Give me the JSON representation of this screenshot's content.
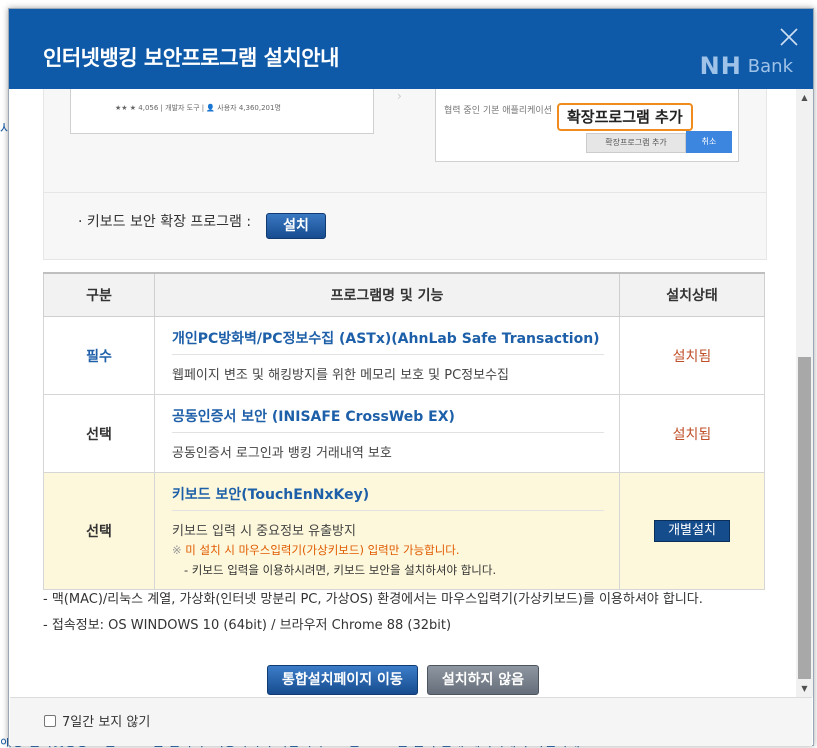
{
  "background": {
    "left_fragment": "사",
    "bottom_fragment": "해당 인터넷뱅킹 보안프로그램 설치 후 이용하시기 바랍니다 · 보안프로그램 설치 안내 페이지에서 확인하세요"
  },
  "modal": {
    "title": "인터넷뱅킹 보안프로그램 설치안내",
    "brand_nh": "NH",
    "brand_bank": "Bank"
  },
  "illustration": {
    "left_caption": "★★ ★ 4,056 | 개발자 도구 | 👤 사용자 4,360,201명",
    "right_caption": "협력 중인 기본 애플리케이션",
    "callout": "확장프로그램 추가",
    "add_label": "확장프로그램 추가",
    "cancel_label": "취소"
  },
  "keyboard_ext": {
    "label": "· 키보드 보안 확장 프로그램 :",
    "install_button": "설치"
  },
  "table": {
    "headers": {
      "type": "구분",
      "program": "프로그램명 및 기능",
      "status": "설치상태"
    },
    "rows": [
      {
        "type": "필수",
        "name": "개인PC방화벽/PC정보수집 (ASTx)(AhnLab Safe Transaction)",
        "desc": "웹페이지 변조 및 해킹방지를 위한 메모리 보호 및 PC정보수집",
        "status": "설치됨"
      },
      {
        "type": "선택",
        "name": "공동인증서 보안 (INISAFE CrossWeb EX)",
        "desc": "공동인증서 로그인과 뱅킹 거래내역 보호",
        "status": "설치됨"
      },
      {
        "type": "선택",
        "name": "키보드 보안(TouchEnNxKey)",
        "desc": "키보드 입력 시 중요정보 유출방지",
        "warn_mark": "※",
        "warn": "미 설치 시 마우스입력기(가상키보드) 입력만 가능합니다.",
        "sub_note": "- 키보드 입력을 이용하시려면, 키보드 보안을 설치하셔야 합니다.",
        "action": "개별설치"
      }
    ]
  },
  "notes": [
    "- 맥(MAC)/리눅스 계열, 가상화(인터넷 망분리 PC, 가상OS) 환경에서는 마우스입력기(가상키보드)를 이용하셔야 합니다.",
    "- 접속정보: OS WINDOWS 10 (64bit) / 브라우저 Chrome 88 (32bit)"
  ],
  "buttons": {
    "goto": "통합설치페이지 이동",
    "skip": "설치하지 않음"
  },
  "footer": {
    "checkbox_label": "7일간 보지 않기",
    "checked": false
  },
  "colors": {
    "header": "#0f5aa8",
    "primary_button": "#174c8f",
    "status_installed": "#c0502a",
    "highlight_row": "#fdf8db",
    "callout_border": "#f08c1e"
  }
}
